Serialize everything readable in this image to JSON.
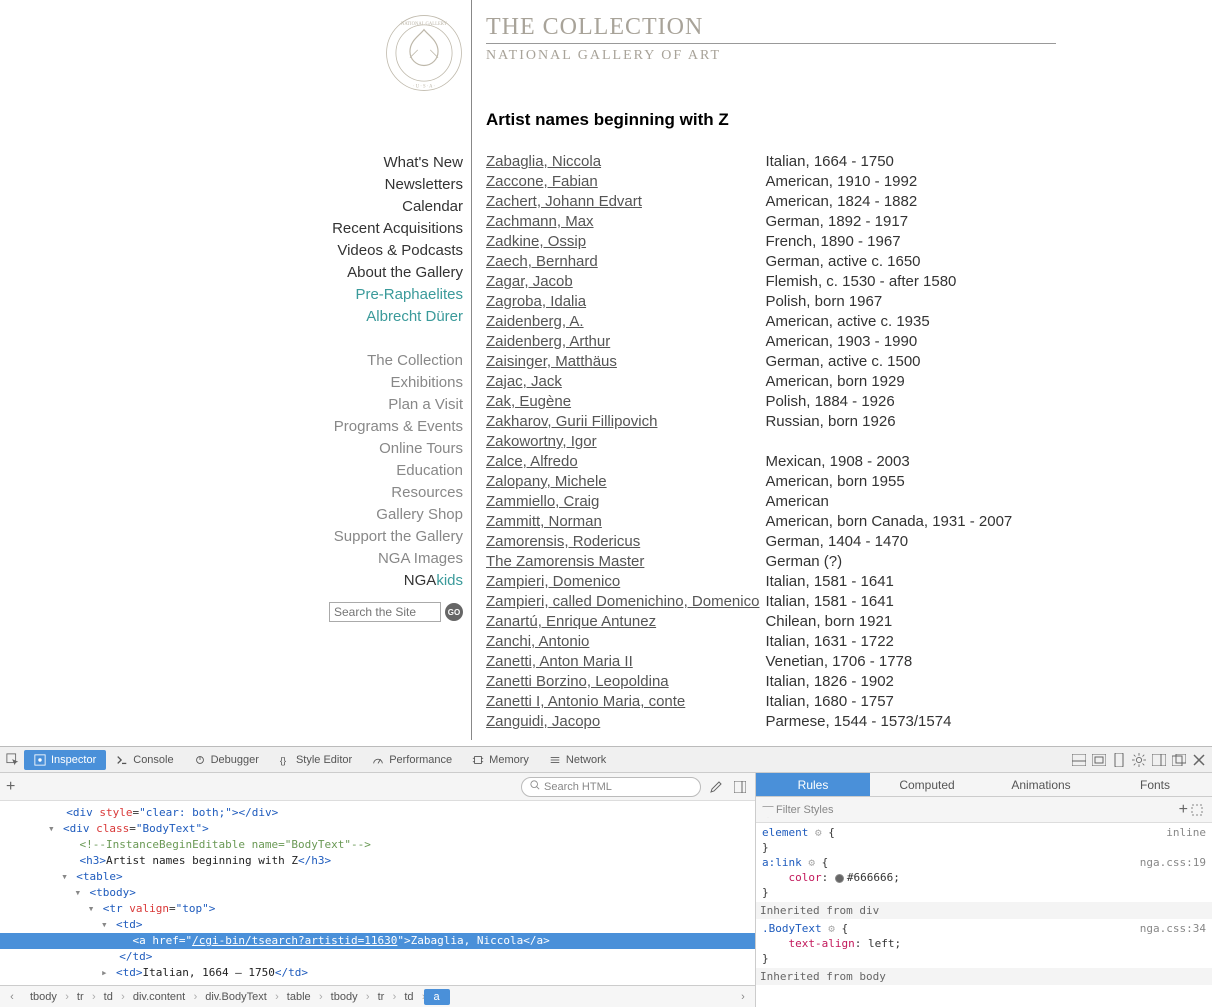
{
  "header": {
    "title": "THE COLLECTION",
    "subtitle": "NATIONAL GALLERY OF ART"
  },
  "sidebar": {
    "group1": [
      {
        "label": "What's New"
      },
      {
        "label": "Newsletters"
      },
      {
        "label": "Calendar"
      },
      {
        "label": "Recent Acquisitions"
      },
      {
        "label": "Videos & Podcasts"
      },
      {
        "label": "About the Gallery"
      },
      {
        "label": "Pre-Raphaelites",
        "teal": true
      },
      {
        "label": "Albrecht Dürer",
        "teal": true
      }
    ],
    "group2": [
      {
        "label": "The Collection"
      },
      {
        "label": "Exhibitions"
      },
      {
        "label": "Plan a Visit"
      },
      {
        "label": "Programs & Events"
      },
      {
        "label": "Online Tours"
      },
      {
        "label": "Education"
      },
      {
        "label": "Resources"
      },
      {
        "label": "Gallery Shop"
      },
      {
        "label": "Support the Gallery"
      },
      {
        "label": "NGA Images"
      }
    ],
    "kids_prefix": "NGA",
    "kids_suffix": "kids",
    "search_placeholder": "Search the Site",
    "go_label": "GO"
  },
  "main": {
    "page_title": "Artist names beginning with Z",
    "artists": [
      {
        "name": "Zabaglia, Niccola",
        "info": "Italian, 1664 - 1750"
      },
      {
        "name": "Zaccone, Fabian",
        "info": "American, 1910 - 1992"
      },
      {
        "name": "Zachert, Johann Edvart",
        "info": "American, 1824 - 1882"
      },
      {
        "name": "Zachmann, Max",
        "info": "German, 1892 - 1917"
      },
      {
        "name": "Zadkine, Ossip",
        "info": "French, 1890 - 1967"
      },
      {
        "name": "Zaech, Bernhard",
        "info": "German, active c. 1650"
      },
      {
        "name": "Zagar, Jacob",
        "info": "Flemish, c. 1530 - after 1580"
      },
      {
        "name": "Zagroba, Idalia",
        "info": "Polish, born 1967"
      },
      {
        "name": "Zaidenberg, A.",
        "info": "American, active c. 1935"
      },
      {
        "name": "Zaidenberg, Arthur",
        "info": "American, 1903 - 1990"
      },
      {
        "name": "Zaisinger, Matthäus",
        "info": "German, active c. 1500"
      },
      {
        "name": "Zajac, Jack",
        "info": "American, born 1929"
      },
      {
        "name": "Zak, Eugène",
        "info": "Polish, 1884 - 1926"
      },
      {
        "name": "Zakharov, Gurii Fillipovich",
        "info": "Russian, born 1926"
      },
      {
        "name": "Zakowortny, Igor",
        "info": ""
      },
      {
        "name": "Zalce, Alfredo",
        "info": "Mexican, 1908 - 2003"
      },
      {
        "name": "Zalopany, Michele",
        "info": "American, born 1955"
      },
      {
        "name": "Zammiello, Craig",
        "info": "American"
      },
      {
        "name": "Zammitt, Norman",
        "info": "American, born Canada, 1931 - 2007"
      },
      {
        "name": "Zamorensis, Rodericus",
        "info": "German, 1404 - 1470"
      },
      {
        "name": "The Zamorensis Master",
        "info": "German (?)"
      },
      {
        "name": "Zampieri, Domenico",
        "info": "Italian, 1581 - 1641"
      },
      {
        "name": "Zampieri, called Domenichino, Domenico",
        "info": "Italian, 1581 - 1641"
      },
      {
        "name": "Zanartú, Enrique Antunez",
        "info": "Chilean, born 1921"
      },
      {
        "name": "Zanchi, Antonio",
        "info": "Italian, 1631 - 1722"
      },
      {
        "name": "Zanetti, Anton Maria II",
        "info": "Venetian, 1706 - 1778"
      },
      {
        "name": "Zanetti Borzino, Leopoldina",
        "info": "Italian, 1826 - 1902"
      },
      {
        "name": "Zanetti I, Antonio Maria, conte",
        "info": "Italian, 1680 - 1757"
      },
      {
        "name": "Zanguidi, Jacopo",
        "info": "Parmese, 1544 - 1573/1574"
      }
    ]
  },
  "devtools": {
    "tabs": [
      "Inspector",
      "Console",
      "Debugger",
      "Style Editor",
      "Performance",
      "Memory",
      "Network"
    ],
    "active_tab": "Inspector",
    "search_placeholder": "Search HTML",
    "subtabs": [
      "Rules",
      "Computed",
      "Animations",
      "Fonts"
    ],
    "active_subtab": "Rules",
    "filter_placeholder": "Filter Styles",
    "dom": {
      "l1": "<div style=\"clear: both;\"></div>",
      "l2_open": "<div class=\"BodyText\">",
      "l3": "<!--InstanceBeginEditable name=\"BodyText\"-->",
      "l4": "<h3>Artist names beginning with Z</h3>",
      "l5": "<table>",
      "l6": "<tbody>",
      "l7": "<tr valign=\"top\">",
      "l8": "<td>",
      "l9_a_open": "<a href=\"",
      "l9_href": "/cgi-bin/tsearch?artistid=11630",
      "l9_a_mid": "\">",
      "l9_text": "Zabaglia, Niccola",
      "l9_a_close": "</a>",
      "l10": "</td>",
      "l11": "<td>Italian, 1664 – 1750</td>"
    },
    "rules": {
      "element_label": "element",
      "inline_label": "inline",
      "alink_sel": "a:link",
      "alink_src": "nga.css:19",
      "alink_prop": "color",
      "alink_val": "#666666",
      "inherit1": "Inherited from div",
      "bodytext_sel": ".BodyText",
      "bodytext_src": "nga.css:34",
      "bodytext_prop": "text-align",
      "bodytext_val": "left",
      "inherit2": "Inherited from body"
    },
    "crumbs": [
      "tbody",
      "tr",
      "td",
      "div.content",
      "div.BodyText",
      "table",
      "tbody",
      "tr",
      "td",
      "a"
    ]
  }
}
